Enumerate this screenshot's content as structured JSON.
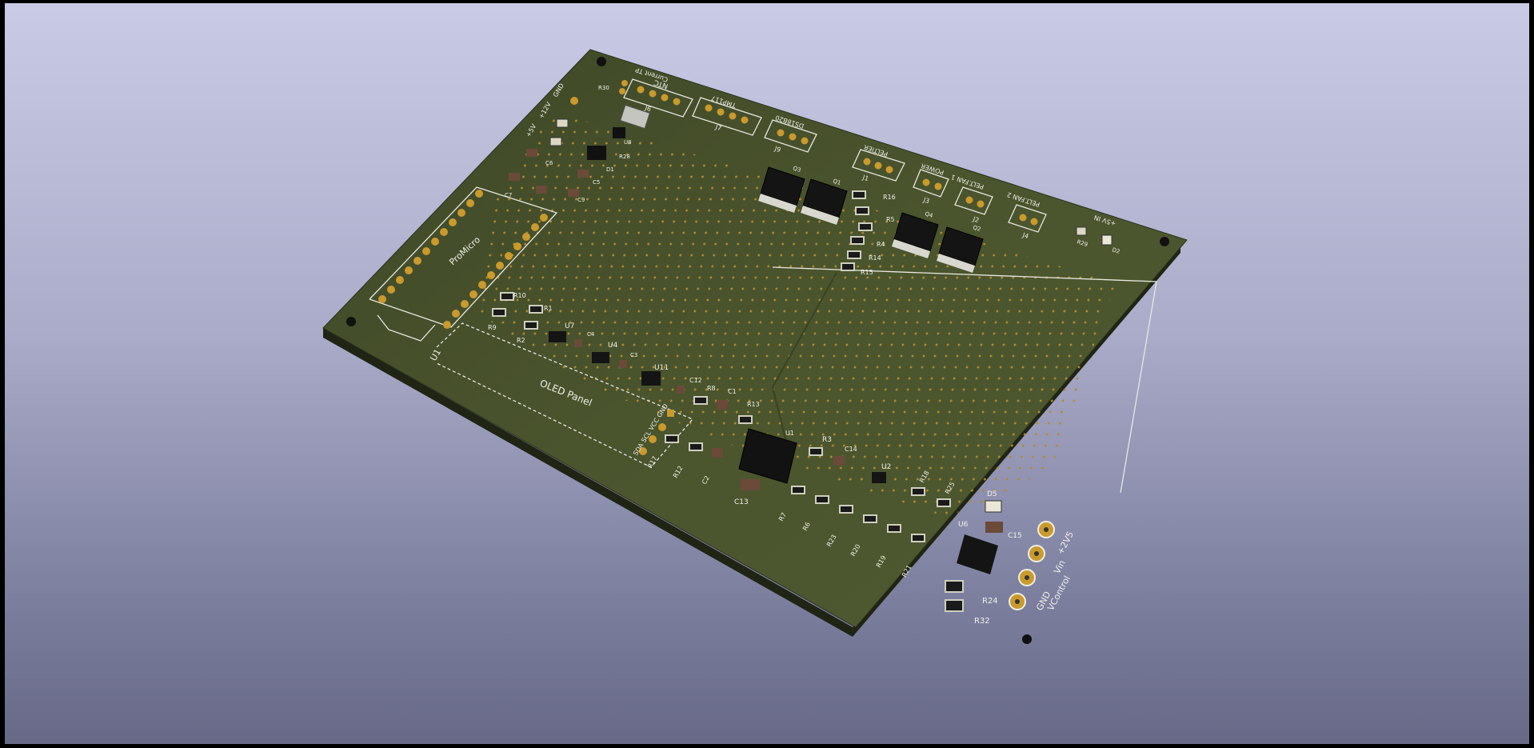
{
  "viewer": {
    "background_top": "#c9cbe6",
    "background_bottom": "#676987",
    "board_color": "#47502c",
    "copper_color": "#c99a2e"
  },
  "board": {
    "connectors": {
      "current_tp": "Current TP",
      "ntc": "NTC",
      "tmp117": "TMP117",
      "ds18b20": "DS18B20",
      "peltier": "PELTIER",
      "power": "POWER",
      "pelt_fan_1": "PELT.FAN 1",
      "pelt_fan_2": "PELT.FAN 2",
      "plus5v_in": "+5V IN"
    },
    "modules": {
      "pro_micro": "ProMicro",
      "oled_panel": "OLED Panel",
      "oled_pins": "SDA SCL VCC GND"
    },
    "test_points": {
      "gnd_top": "GND",
      "v12": "+12V",
      "v5": "+5V",
      "v2v5": "+2V5",
      "vin": "Vin",
      "gnd_bottom": "GND",
      "vcontrol": "VControl"
    },
    "refs": {
      "J6": "J6",
      "J7": "J7",
      "J9": "J9",
      "J1": "J1",
      "J3": "J3",
      "J2": "J2",
      "J4": "J4",
      "U1": "U1",
      "U2": "U2",
      "U4": "U4",
      "U6": "U6",
      "U7": "U7",
      "U8": "U8",
      "U11": "U11",
      "R1": "R1",
      "R2": "R2",
      "R3": "R3",
      "R4": "R4",
      "R5": "R5",
      "R6": "R6",
      "R7": "R7",
      "R8": "R8",
      "R9": "R9",
      "R10": "R10",
      "R12": "R12",
      "R13": "R13",
      "R14": "R14",
      "R15": "R15",
      "R16": "R16",
      "R17": "R17",
      "R18": "R18",
      "R19": "R19",
      "R20": "R20",
      "R21": "R21",
      "R23": "R23",
      "R24": "R24",
      "R25": "R25",
      "R28": "R28",
      "R29": "R29",
      "R30": "R30",
      "R32": "R32",
      "C1": "C1",
      "C2": "C2",
      "C3": "C3",
      "C4": "C4",
      "C5": "C5",
      "C6": "C6",
      "C7": "C7",
      "C9": "C9",
      "C12": "C12",
      "C13": "C13",
      "C14": "C14",
      "C15": "C15",
      "D1": "D1",
      "D2": "D2",
      "D5": "D5",
      "Q1": "Q1",
      "Q2": "Q2",
      "Q3": "Q3",
      "Q4": "Q4"
    }
  }
}
